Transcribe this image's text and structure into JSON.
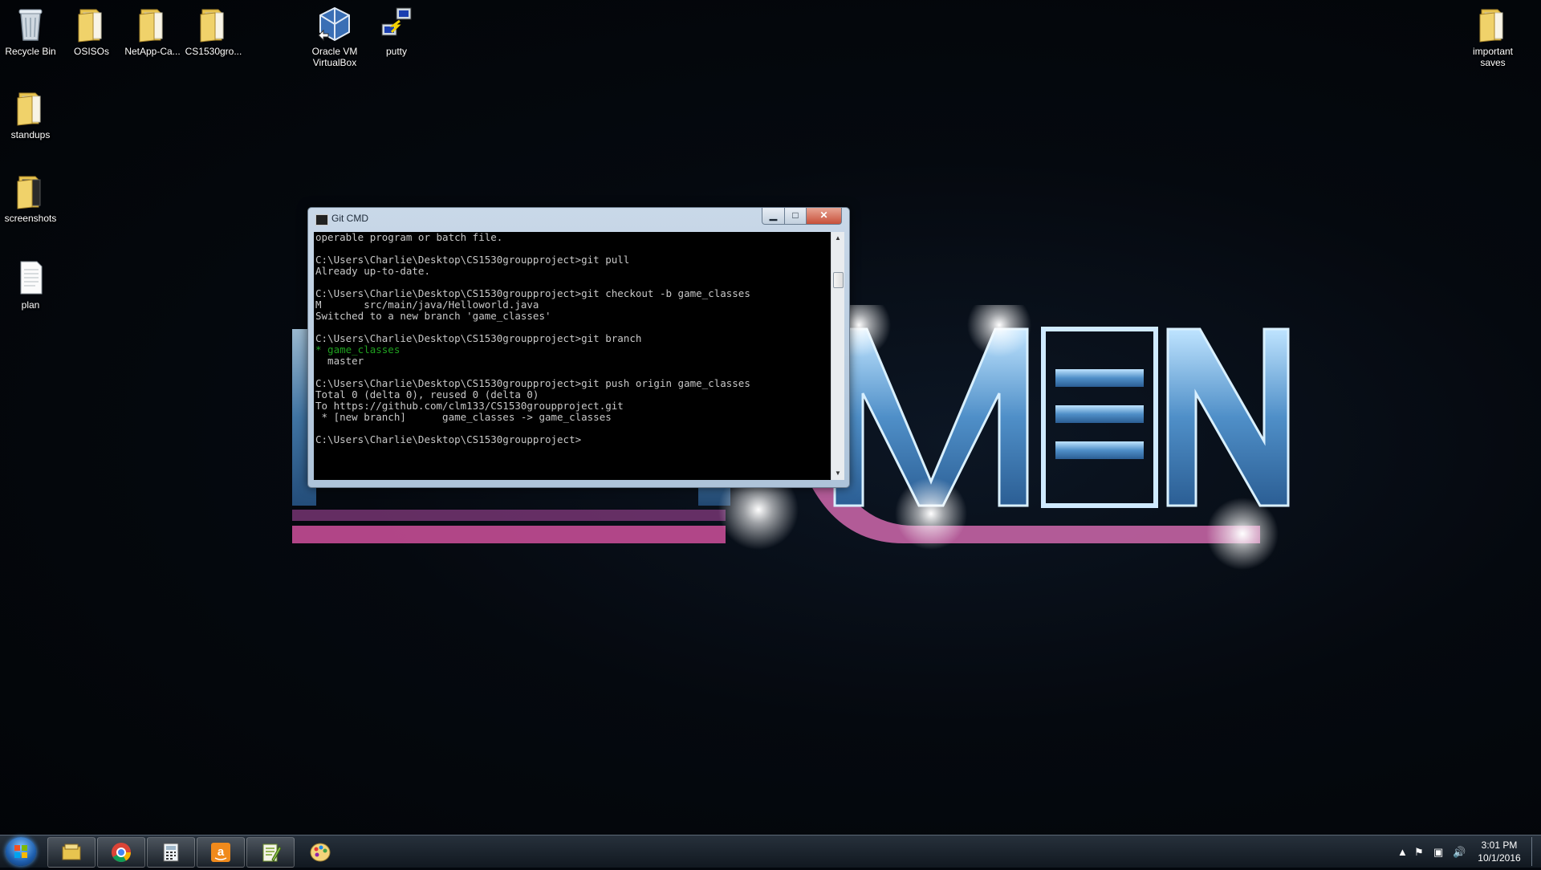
{
  "desktop": {
    "icons": [
      {
        "label": "Recycle Bin",
        "kind": "recycle-bin"
      },
      {
        "label": "OSISOs",
        "kind": "folder"
      },
      {
        "label": "NetApp-Ca...",
        "kind": "folder"
      },
      {
        "label": "CS1530gro...",
        "kind": "folder"
      },
      {
        "label": "Oracle VM VirtualBox",
        "kind": "virtualbox"
      },
      {
        "label": "putty",
        "kind": "putty"
      },
      {
        "label": "important saves",
        "kind": "folder"
      },
      {
        "label": "standups",
        "kind": "folder"
      },
      {
        "label": "screenshots",
        "kind": "folder"
      },
      {
        "label": "plan",
        "kind": "text-file"
      }
    ]
  },
  "window": {
    "title": "Git CMD",
    "console_lines": [
      "operable program or batch file.",
      "",
      "C:\\Users\\Charlie\\Desktop\\CS1530groupproject>git pull",
      "Already up-to-date.",
      "",
      "C:\\Users\\Charlie\\Desktop\\CS1530groupproject>git checkout -b game_classes",
      "M       src/main/java/Helloworld.java",
      "Switched to a new branch 'game_classes'",
      "",
      "C:\\Users\\Charlie\\Desktop\\CS1530groupproject>git branch",
      "* game_classes",
      "  master",
      "",
      "C:\\Users\\Charlie\\Desktop\\CS1530groupproject>git push origin game_classes",
      "Total 0 (delta 0), reused 0 (delta 0)",
      "To https://github.com/clm133/CS1530groupproject.git",
      " * [new branch]      game_classes -> game_classes",
      "",
      "C:\\Users\\Charlie\\Desktop\\CS1530groupproject>"
    ],
    "highlight_line_index": 10,
    "highlight_color": "#1fa01f"
  },
  "taskbar": {
    "pinned": [
      "file-explorer",
      "chrome",
      "calculator",
      "amazon",
      "notepad-plus-plus",
      "paint"
    ],
    "clock_time": "3:01 PM",
    "clock_date": "10/1/2016"
  }
}
